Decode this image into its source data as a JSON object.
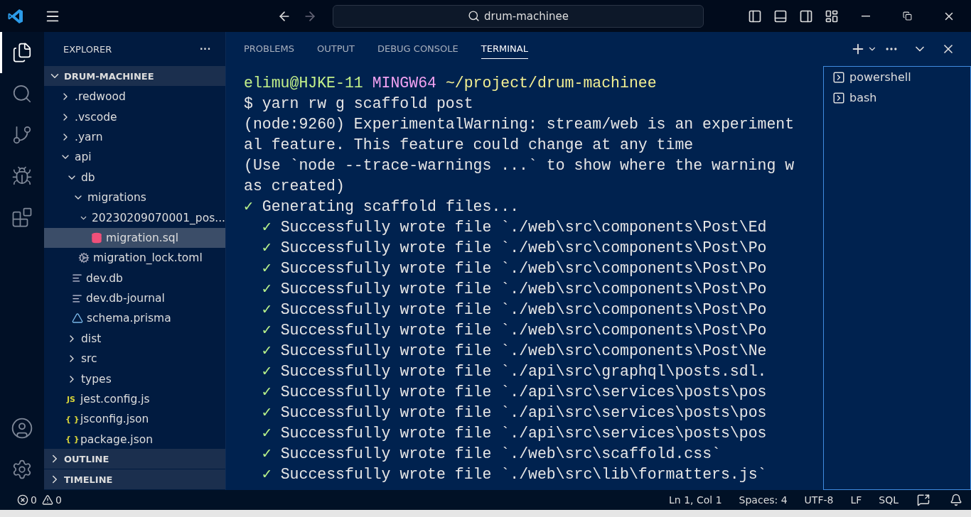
{
  "title_bar": {
    "search": "drum-machinee"
  },
  "activity_bar": {
    "items": [
      {
        "kind": "files",
        "selected": true
      },
      {
        "kind": "search",
        "selected": false
      },
      {
        "kind": "source-control",
        "selected": false
      },
      {
        "kind": "run-debug",
        "selected": false
      },
      {
        "kind": "extensions",
        "selected": false
      }
    ]
  },
  "sidebar": {
    "title": "EXPLORER",
    "more": "···",
    "root": {
      "label": "DRUM-MACHINEE",
      "expanded": true
    },
    "tree": [
      {
        "kind": "folder",
        "label": ".redwood",
        "expanded": false,
        "selected": false
      },
      {
        "kind": "folder",
        "label": ".vscode",
        "expanded": false,
        "selected": false
      },
      {
        "kind": "folder",
        "label": ".yarn",
        "expanded": false,
        "selected": false
      },
      {
        "kind": "folder",
        "label": "api",
        "expanded": true,
        "selected": false,
        "children": [
          {
            "kind": "folder",
            "label": "db",
            "expanded": true,
            "selected": false,
            "children": [
              {
                "kind": "folder",
                "label": "migrations",
                "expanded": true,
                "selected": false,
                "children": [
                  {
                    "kind": "folder",
                    "label": "20230209070001_pos...",
                    "expanded": true,
                    "selected": false,
                    "children": [
                      {
                        "kind": "sql",
                        "label": "migration.sql",
                        "selected": true
                      }
                    ]
                  }
                ]
              },
              {
                "kind": "config",
                "label": "migration_lock.toml",
                "selected": false
              }
            ]
          },
          {
            "kind": "text",
            "label": "dev.db",
            "selected": false
          },
          {
            "kind": "text",
            "label": "dev.db-journal",
            "selected": false
          },
          {
            "kind": "prisma",
            "label": "schema.prisma",
            "selected": false
          },
          {
            "kind": "folder",
            "label": "dist",
            "expanded": false,
            "selected": false
          },
          {
            "kind": "folder",
            "label": "src",
            "expanded": false,
            "selected": false
          },
          {
            "kind": "folder",
            "label": "types",
            "expanded": false,
            "selected": false
          }
        ]
      },
      {
        "kind": "js",
        "label": "jest.config.js",
        "badge": "JS",
        "selected": false
      },
      {
        "kind": "json",
        "label": "jsconfig.json",
        "badge": "{ }",
        "selected": false
      },
      {
        "kind": "json",
        "label": "package.json",
        "badge": "{ }",
        "selected": false
      }
    ],
    "sections": [
      {
        "label": "OUTLINE",
        "expanded": false
      },
      {
        "label": "TIMELINE",
        "expanded": false
      }
    ]
  },
  "panel": {
    "tabs": [
      {
        "label": "PROBLEMS",
        "selected": false
      },
      {
        "label": "OUTPUT",
        "selected": false
      },
      {
        "label": "DEBUG CONSOLE",
        "selected": false
      },
      {
        "label": "TERMINAL",
        "selected": true
      }
    ],
    "terminal_lines": [
      {
        "kind": "prompt",
        "user": "elimu@HJKE-11",
        "system": "MINGW64",
        "path": "~/project/drum-machinee"
      },
      {
        "kind": "plain",
        "text": "$ yarn rw g scaffold post"
      },
      {
        "kind": "plain",
        "text": "(node:9260) ExperimentalWarning: stream/web is an experiment"
      },
      {
        "kind": "plain",
        "text": "al feature. This feature could change at any time"
      },
      {
        "kind": "plain",
        "text": "(Use `node --trace-warnings ...` to show where the warning w"
      },
      {
        "kind": "plain",
        "text": "as created)"
      },
      {
        "kind": "task",
        "check": "✓",
        "text": "Generating scaffold files..."
      },
      {
        "kind": "subtask",
        "check": "✓",
        "text": "Successfully wrote file `./web\\src\\components\\Post\\Ed"
      },
      {
        "kind": "subtask",
        "check": "✓",
        "text": "Successfully wrote file `./web\\src\\components\\Post\\Po"
      },
      {
        "kind": "subtask",
        "check": "✓",
        "text": "Successfully wrote file `./web\\src\\components\\Post\\Po"
      },
      {
        "kind": "subtask",
        "check": "✓",
        "text": "Successfully wrote file `./web\\src\\components\\Post\\Po"
      },
      {
        "kind": "subtask",
        "check": "✓",
        "text": "Successfully wrote file `./web\\src\\components\\Post\\Po"
      },
      {
        "kind": "subtask",
        "check": "✓",
        "text": "Successfully wrote file `./web\\src\\components\\Post\\Po"
      },
      {
        "kind": "subtask",
        "check": "✓",
        "text": "Successfully wrote file `./web\\src\\components\\Post\\Ne"
      },
      {
        "kind": "subtask",
        "check": "✓",
        "text": "Successfully wrote file `./api\\src\\graphql\\posts.sdl."
      },
      {
        "kind": "subtask",
        "check": "✓",
        "text": "Successfully wrote file `./api\\src\\services\\posts\\pos"
      },
      {
        "kind": "subtask",
        "check": "✓",
        "text": "Successfully wrote file `./api\\src\\services\\posts\\pos"
      },
      {
        "kind": "subtask",
        "check": "✓",
        "text": "Successfully wrote file `./api\\src\\services\\posts\\pos"
      },
      {
        "kind": "subtask",
        "check": "✓",
        "text": "Successfully wrote file `./web\\src\\scaffold.css`"
      },
      {
        "kind": "subtask",
        "check": "✓",
        "text": "Successfully wrote file `./web\\src\\lib\\formatters.js`"
      }
    ],
    "terminals": [
      {
        "label": "powershell",
        "selected": false
      },
      {
        "label": "bash",
        "selected": false
      }
    ]
  },
  "status_bar": {
    "errors": "0",
    "warnings": "0",
    "items": [
      "Ln 1, Col 1",
      "Spaces: 4",
      "UTF-8",
      "LF",
      "SQL"
    ]
  }
}
